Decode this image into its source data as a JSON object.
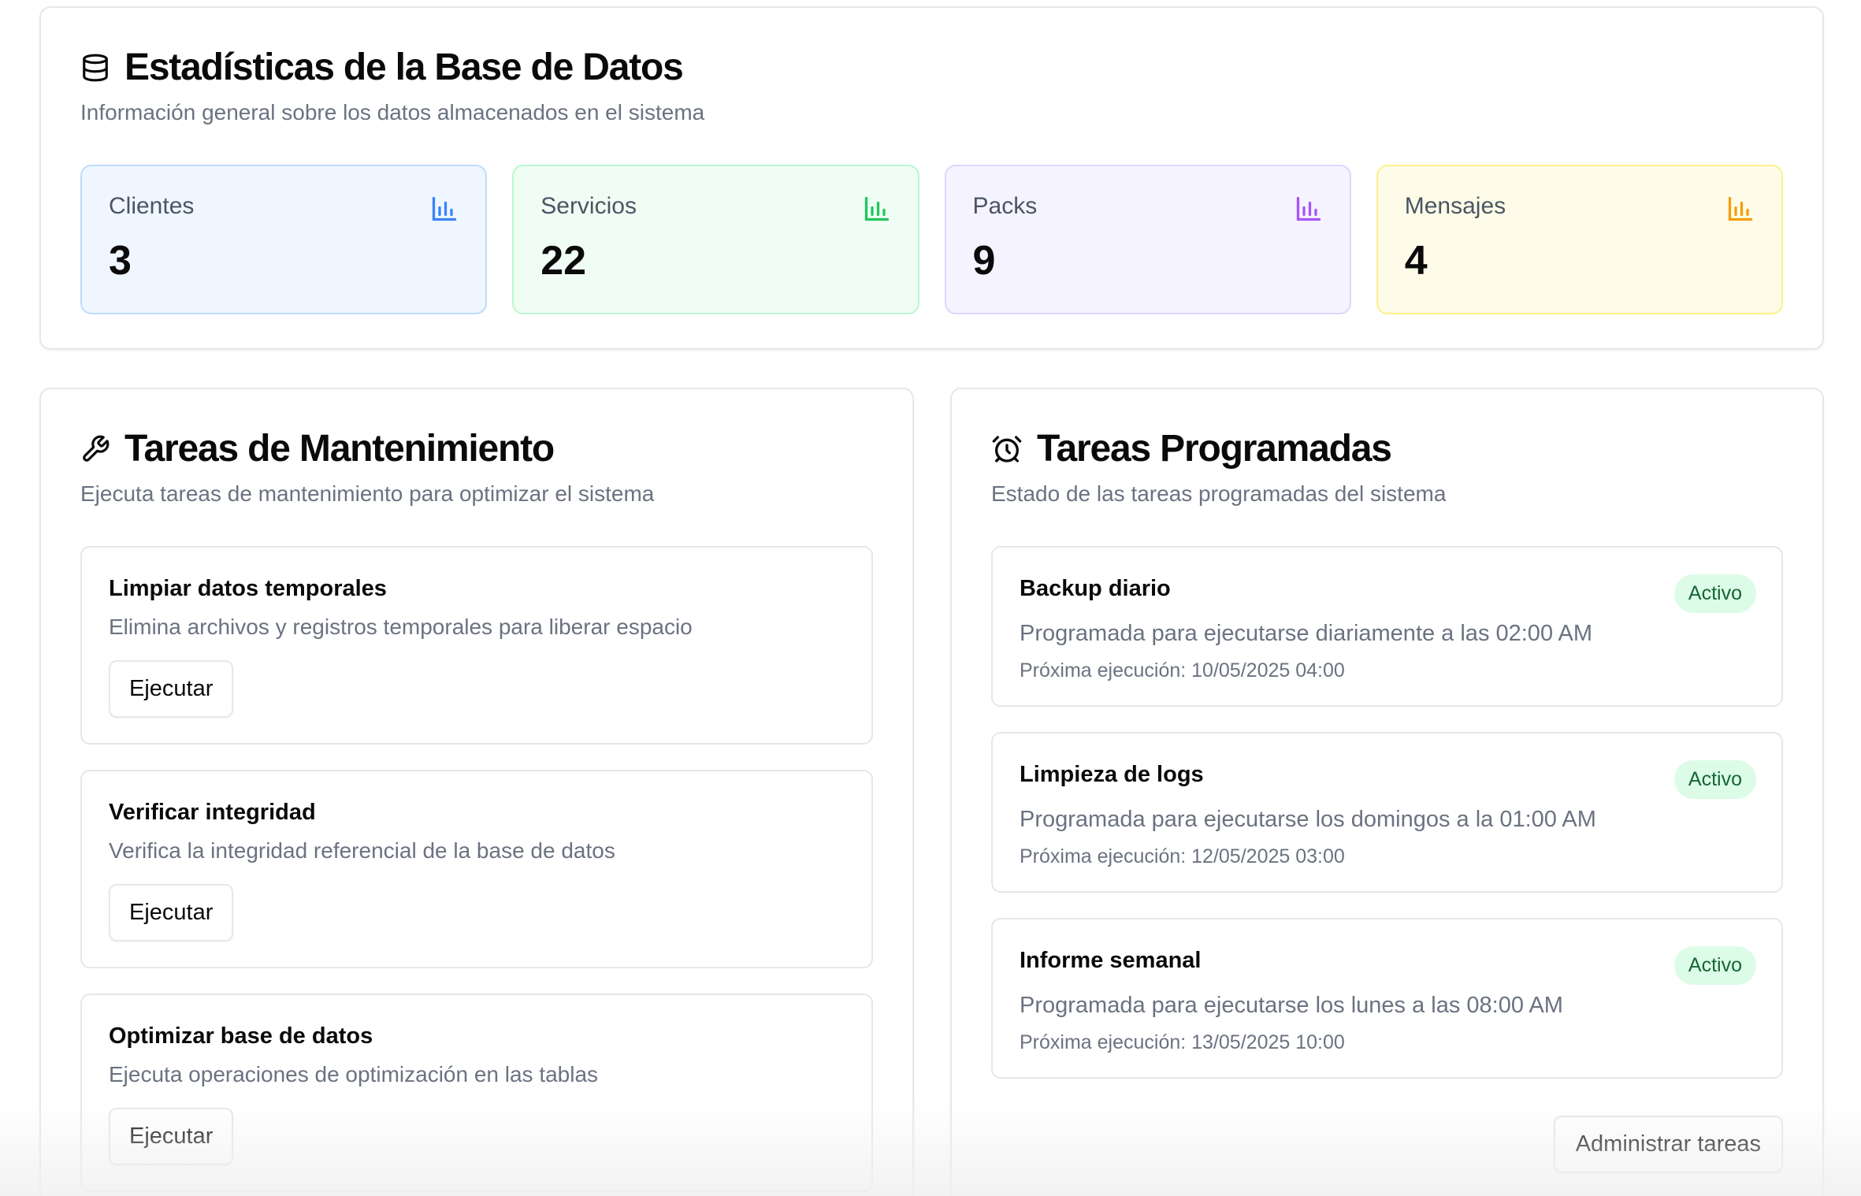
{
  "stats": {
    "title": "Estadísticas de la Base de Datos",
    "subtitle": "Información general sobre los datos almacenados en el sistema",
    "icon": "database-icon",
    "items": [
      {
        "label": "Clientes",
        "value": "3",
        "bg": "#eff6ff",
        "border": "#bfdbfe",
        "accent": "#3b82f6"
      },
      {
        "label": "Servicios",
        "value": "22",
        "bg": "#f0fdf4",
        "border": "#bbf7d0",
        "accent": "#22c55e"
      },
      {
        "label": "Packs",
        "value": "9",
        "bg": "#f5f3ff",
        "border": "#ddd6fe",
        "accent": "#a855f7"
      },
      {
        "label": "Mensajes",
        "value": "4",
        "bg": "#fefce8",
        "border": "#fef08a",
        "accent": "#f59e0b"
      }
    ]
  },
  "maintenance": {
    "title": "Tareas de Mantenimiento",
    "subtitle": "Ejecuta tareas de mantenimiento para optimizar el sistema",
    "icon": "wrench-icon",
    "tasks": [
      {
        "name": "Limpiar datos temporales",
        "description": "Elimina archivos y registros temporales para liberar espacio",
        "button": "Ejecutar"
      },
      {
        "name": "Verificar integridad",
        "description": "Verifica la integridad referencial de la base de datos",
        "button": "Ejecutar"
      },
      {
        "name": "Optimizar base de datos",
        "description": "Ejecuta operaciones de optimización en las tablas",
        "button": "Ejecutar"
      }
    ]
  },
  "scheduled": {
    "title": "Tareas Programadas",
    "subtitle": "Estado de las tareas programadas del sistema",
    "icon": "alarm-clock-icon",
    "tasks": [
      {
        "name": "Backup diario",
        "status": "Activo",
        "description": "Programada para ejecutarse diariamente a las 02:00 AM",
        "next": "Próxima ejecución: 10/05/2025 04:00"
      },
      {
        "name": "Limpieza de logs",
        "status": "Activo",
        "description": "Programada para ejecutarse los domingos a la 01:00 AM",
        "next": "Próxima ejecución: 12/05/2025 03:00"
      },
      {
        "name": "Informe semanal",
        "status": "Activo",
        "description": "Programada para ejecutarse los lunes a las 08:00 AM",
        "next": "Próxima ejecución: 13/05/2025 10:00"
      }
    ],
    "admin_button": "Administrar tareas"
  }
}
